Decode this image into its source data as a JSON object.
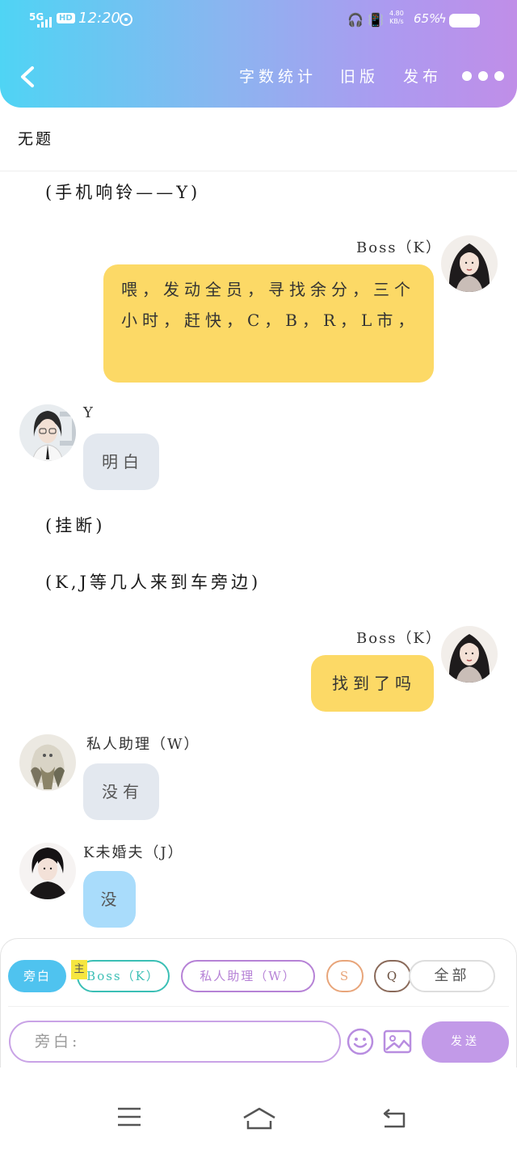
{
  "status_bar": {
    "network": "5G",
    "hd": "HD",
    "time": "12:20",
    "speed_value": "4.80",
    "speed_unit": "KB/s",
    "battery": "65%"
  },
  "header": {
    "back_icon": "chevron-left-icon",
    "actions": {
      "word_count": "字数统计",
      "old_version": "旧版",
      "publish": "发布"
    },
    "more_icon": "more-dots-icon"
  },
  "document": {
    "title": "无题"
  },
  "messages": {
    "narr_ring": "(手机响铃——Y)",
    "boss1": {
      "speaker": "Boss（K）",
      "text": "喂，发动全员，寻找余分，三个小时，赶快，C，B，R，L市，",
      "avatar": "female-avatar"
    },
    "y1": {
      "speaker": "Y",
      "text": "明白",
      "avatar": "male-glasses-avatar"
    },
    "narr_hangup": "(挂断)",
    "narr_car": "(K,J等几人来到车旁边)",
    "boss2": {
      "speaker": "Boss（K）",
      "text": "找到了吗",
      "avatar": "female-avatar"
    },
    "assistant": {
      "speaker": "私人助理（W）",
      "text": "没有",
      "avatar": "ghost-art-avatar"
    },
    "fiance": {
      "speaker": "K未婚夫（J）",
      "text": "没",
      "avatar": "male-dark-avatar"
    }
  },
  "composer": {
    "chips": {
      "narration": "旁白",
      "boss": "Boss（K）",
      "assistant": "私人助理（W）",
      "s": "S",
      "q": "Q",
      "all": "全部"
    },
    "main_tag": "主",
    "input_placeholder": "旁白:",
    "emoji_icon": "emoji-icon",
    "image_icon": "image-icon",
    "send": "发送"
  },
  "system_nav": {
    "menu_icon": "menu-icon",
    "home_icon": "home-icon",
    "back_icon": "back-icon"
  },
  "colors": {
    "header_gradient_start": "#4fd4f4",
    "header_gradient_end": "#c08ee8",
    "boss_bubble": "#fcd966",
    "assistant_bubble": "#e3e8ef",
    "fiance_bubble": "#a9dcfb",
    "send_button": "#c29ae8"
  }
}
